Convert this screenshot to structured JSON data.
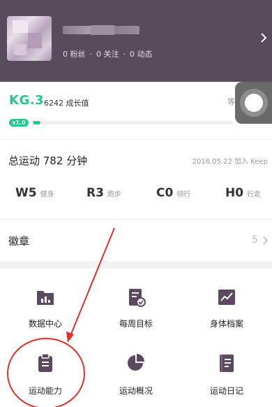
{
  "header": {
    "stats": [
      "0 粉丝",
      "0 关注",
      "0 动态"
    ],
    "dot": "·",
    "chevron_icon": "chevron-right-icon"
  },
  "level": {
    "name": "KG.3",
    "growth": "6242 成长值",
    "more": "等",
    "multiplier": "x1.0",
    "progress": 0.04
  },
  "summary": {
    "total": "总运动 782 分钟",
    "joined": "2016.05.22 加入 Keep"
  },
  "sport_levels": [
    {
      "code": "W5",
      "label": "健身"
    },
    {
      "code": "R3",
      "label": "跑步"
    },
    {
      "code": "C0",
      "label": "骑行"
    },
    {
      "code": "H0",
      "label": "行走"
    }
  ],
  "badges": {
    "title": "徽章",
    "count": "5"
  },
  "grid": [
    {
      "label": "数据中心",
      "icon": "bar-chart-icon"
    },
    {
      "label": "每周目标",
      "icon": "weekly-goal-icon"
    },
    {
      "label": "身体档案",
      "icon": "line-chart-icon"
    },
    {
      "label": "运动能力",
      "icon": "clipboard-icon"
    },
    {
      "label": "运动概况",
      "icon": "pie-chart-icon"
    },
    {
      "label": "运动日记",
      "icon": "diary-icon"
    }
  ],
  "colors": {
    "header_bg": "#584b5c",
    "accent_green": "#24c789",
    "icon_purple": "#5b4a5f",
    "annotation_red": "#e0302b"
  }
}
